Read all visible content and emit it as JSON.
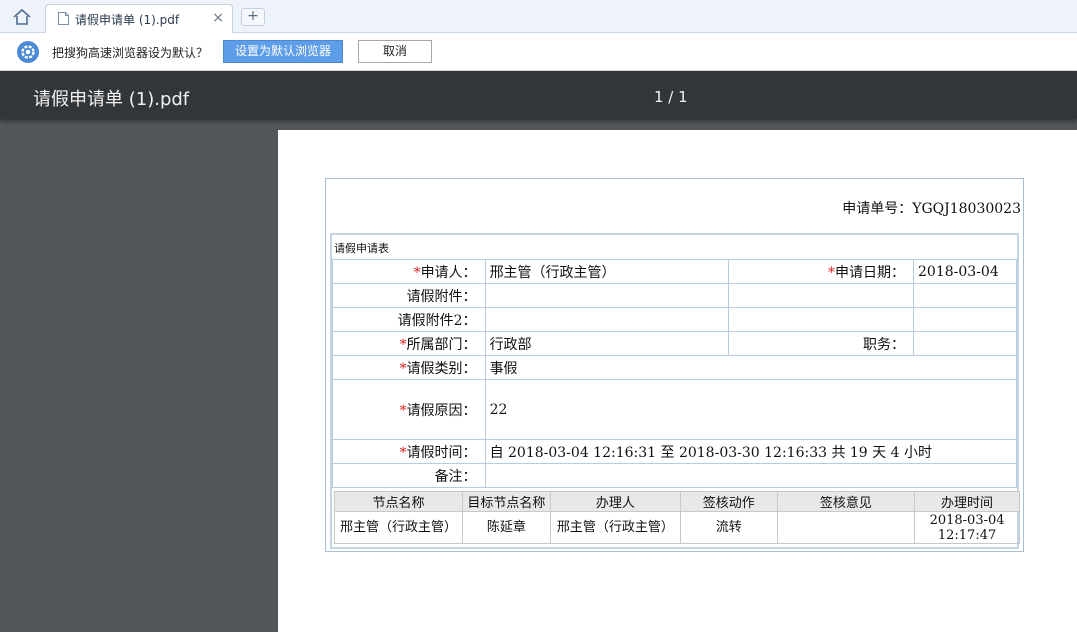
{
  "browser": {
    "tab_title": "请假申请单 (1).pdf",
    "tab_close": "×",
    "new_tab": "+"
  },
  "infobar": {
    "message": "把搜狗高速浏览器设为默认？",
    "set_default_label": "设置为默认浏览器",
    "cancel_label": "取消"
  },
  "viewer": {
    "doc_title": "请假申请单 (1).pdf",
    "page_counter": "1 / 1"
  },
  "form": {
    "number_label": "申请单号：",
    "number_value": "YGQJ18030023",
    "heading": "请假申请表",
    "required_mark": "*",
    "rows": {
      "applicant_label": "申请人：",
      "applicant_value": "邢主管（行政主管）",
      "date_label": "申请日期：",
      "date_value": "2018-03-04",
      "attachment_label": "请假附件：",
      "attachment2_label": "请假附件2：",
      "dept_label": "所属部门：",
      "dept_value": "行政部",
      "position_label": "职务：",
      "type_label": "请假类别：",
      "type_value": "事假",
      "reason_label": "请假原因：",
      "reason_value": "22",
      "time_label": "请假时间：",
      "time_value": "自 2018-03-04 12:16:31 至 2018-03-30 12:16:33 共 19 天 4 小时",
      "note_label": "备注："
    },
    "log": {
      "headers": [
        "节点名称",
        "目标节点名称",
        "办理人",
        "签核动作",
        "签核意见",
        "办理时间"
      ],
      "row": {
        "node": "邢主管（行政主管）",
        "target": "陈延章",
        "handler": "邢主管（行政主管）",
        "action": "流转",
        "opinion": "",
        "time_date": "2018-03-04",
        "time_clock": "12:17:47"
      }
    }
  }
}
